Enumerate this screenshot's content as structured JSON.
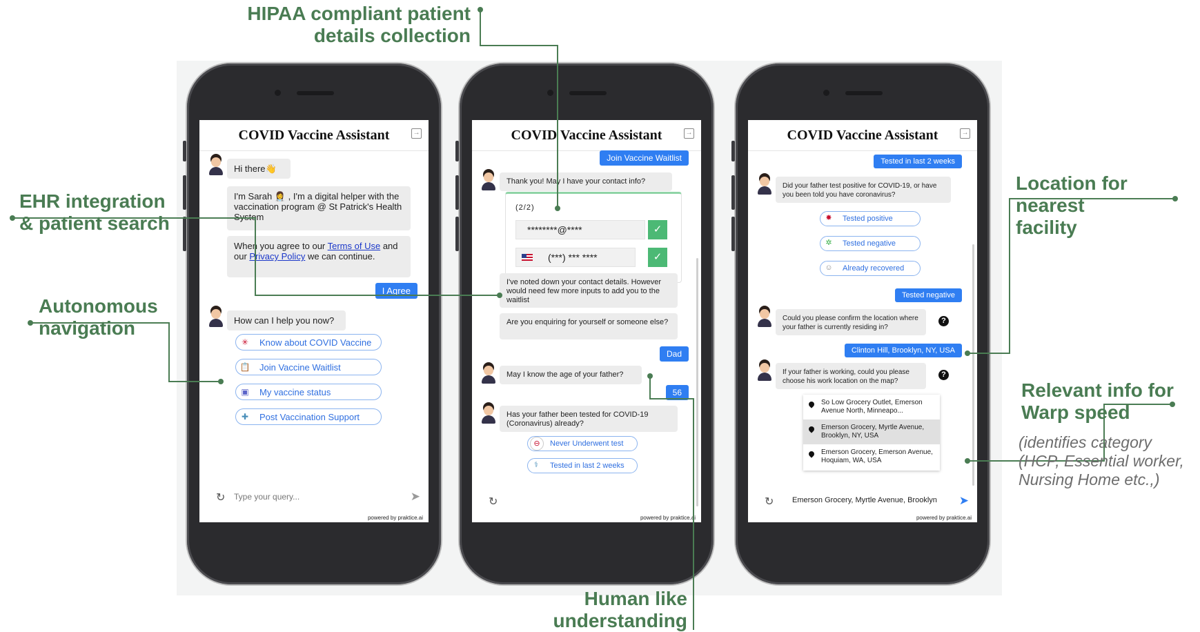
{
  "app_title": "COVID Vaccine Assistant",
  "powered_by": "powered by praktice.ai",
  "annotations": {
    "hipaa": [
      "HIPAA compliant patient",
      "details collection"
    ],
    "ehr": [
      "EHR integration",
      "& patient search"
    ],
    "navigation": [
      "Autonomous",
      "navigation"
    ],
    "location": [
      "Location for",
      "nearest",
      "facility"
    ],
    "relevant": [
      "Relevant info for",
      "Warp speed"
    ],
    "relevant_note": [
      "(identifies category",
      "(HCP, Essential worker,",
      "Nursing Home etc.,)"
    ],
    "human": [
      "Human like",
      "understanding"
    ]
  },
  "phone1": {
    "greeting": "Hi there👋",
    "intro": "I'm Sarah 👩‍⚕️ , I'm a digital helper with the vaccination program @ St Patrick's Health System",
    "agree_pre": "When you agree to our ",
    "terms": "Terms of Use",
    "agree_mid": " and our ",
    "privacy": "Privacy Policy",
    "agree_post": " we can continue.",
    "agree_button": "I Agree",
    "help": "How can I help you now?",
    "options": [
      "Know about COVID Vaccine",
      "Join Vaccine Waitlist",
      "My vaccine status",
      "Post Vaccination Support"
    ],
    "placeholder": "Type your query..."
  },
  "phone2": {
    "user_join": "Join Vaccine Waitlist",
    "contact_q": "Thank you! May I have your contact info?",
    "form_step": "(2/2)",
    "email_mask": "********@****",
    "phone_mask": "(***) *** ****",
    "noted": "I've noted down your contact details. However would need few more inputs to add you to the waitlist",
    "enquire": "Are you enquiring for yourself or someone else?",
    "user_dad": "Dad",
    "age_q": "May I know the age of your father?",
    "user_age": "56",
    "tested_q": "Has your father been tested for COVID-19 (Coronavirus) already?",
    "options": [
      "Never Underwent test",
      "Tested in last 2 weeks"
    ]
  },
  "phone3": {
    "user_tested": "Tested in last 2 weeks",
    "positive_q": "Did your father test positive for COVID-19, or have you been told you have coronavirus?",
    "options": [
      "Tested positive",
      "Tested negative",
      "Already recovered"
    ],
    "user_negative": "Tested negative",
    "location_q": "Could you please confirm the location where your father is currently residing in?",
    "user_location": "Clinton Hill, Brooklyn, NY, USA",
    "work_q": "If your father is working, could you please choose his work location on the map?",
    "locations": [
      "So Low Grocery Outlet, Emerson Avenue North, Minneapo...",
      "Emerson Grocery, Myrtle Avenue, Brooklyn, NY, USA",
      "Emerson Grocery, Emerson Avenue, Hoquiam, WA, USA"
    ],
    "input_value": "Emerson Grocery, Myrtle Avenue, Brooklyn"
  },
  "colors": {
    "annotation": "#4a7c53",
    "user_bubble": "#2f7ef2",
    "chip_text": "#2f6fe0"
  }
}
